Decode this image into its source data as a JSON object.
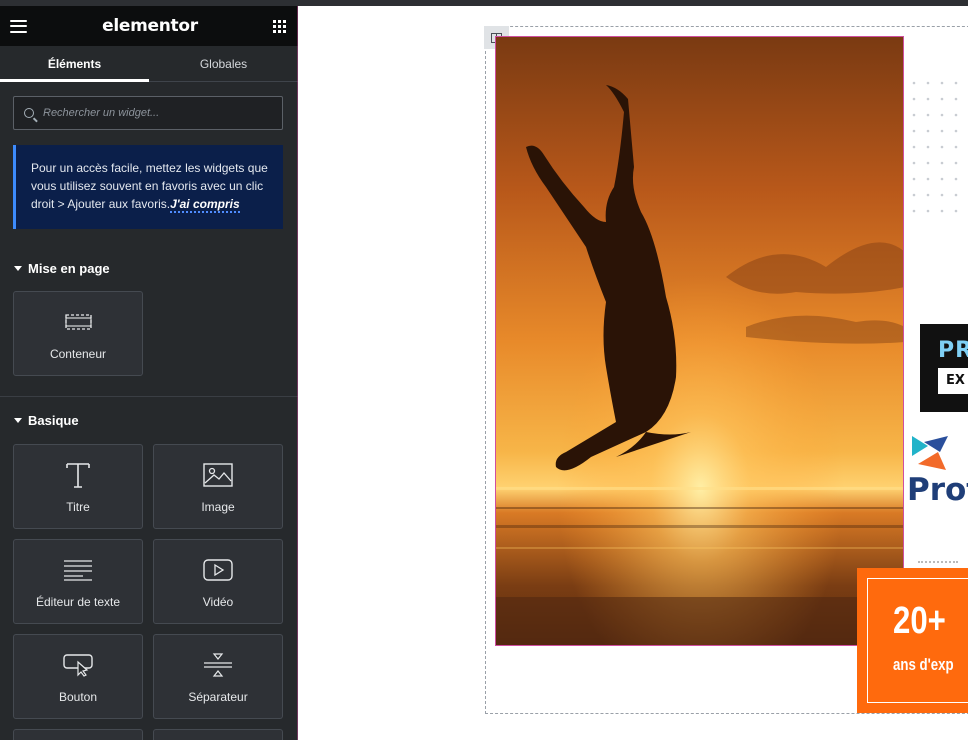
{
  "header": {
    "logo": "elementor",
    "menu_icon": "hamburger-menu-icon",
    "apps_icon": "grid-apps-icon"
  },
  "tabs": [
    {
      "label": "Éléments",
      "active": true
    },
    {
      "label": "Globales",
      "active": false
    }
  ],
  "search": {
    "placeholder": "Rechercher un widget..."
  },
  "notice": {
    "text": "Pour un accès facile, mettez les widgets que vous utilisez souvent en favoris avec un clic droit > Ajouter aux favoris.",
    "link": "J'ai compris"
  },
  "sections": {
    "layout": {
      "title": "Mise en page",
      "widgets": [
        {
          "label": "Conteneur",
          "icon": "container-icon"
        }
      ]
    },
    "basic": {
      "title": "Basique",
      "widgets": [
        {
          "label": "Titre",
          "icon": "heading-icon"
        },
        {
          "label": "Image",
          "icon": "image-icon"
        },
        {
          "label": "Éditeur de texte",
          "icon": "text-editor-icon"
        },
        {
          "label": "Vidéo",
          "icon": "video-icon"
        },
        {
          "label": "Bouton",
          "icon": "button-icon"
        },
        {
          "label": "Séparateur",
          "icon": "divider-icon"
        }
      ]
    }
  },
  "canvas": {
    "badge_text_1": "PR",
    "badge_text_2": "EX",
    "brand_text": "Prot",
    "stat_value": "20+",
    "stat_label": "ans d'exp",
    "photo_subject": "silhouette-jumping-at-sunset-beach"
  },
  "colors": {
    "sidebar_bg": "#26292c",
    "header_bg": "#0c0d0e",
    "notice_bg": "#0b1f4a",
    "accent_blue": "#3d8bfd",
    "orange": "#ff6a0d",
    "brand_blue": "#1f3e78",
    "selection_pink": "#d04ea0"
  }
}
